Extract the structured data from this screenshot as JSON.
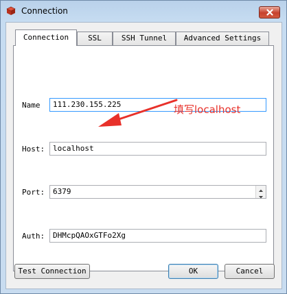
{
  "window": {
    "title": "Connection"
  },
  "tabs": [
    {
      "label": "Connection",
      "active": true
    },
    {
      "label": "SSL",
      "active": false
    },
    {
      "label": "SSH Tunnel",
      "active": false
    },
    {
      "label": "Advanced Settings",
      "active": false
    }
  ],
  "form": {
    "name_label": "Name",
    "name_value": "111.230.155.225",
    "host_label": "Host:",
    "host_value": "localhost",
    "port_label": "Port:",
    "port_value": "6379",
    "auth_label": "Auth:",
    "auth_value": "DHMcpQAOxGTFo2Xg"
  },
  "annotation": {
    "text": "填写localhost",
    "color": "#e8312a"
  },
  "buttons": {
    "test_connection": "Test Connection",
    "ok": "OK",
    "cancel": "Cancel"
  },
  "icons": {
    "app": "redis-cube-icon",
    "close": "close-icon"
  }
}
